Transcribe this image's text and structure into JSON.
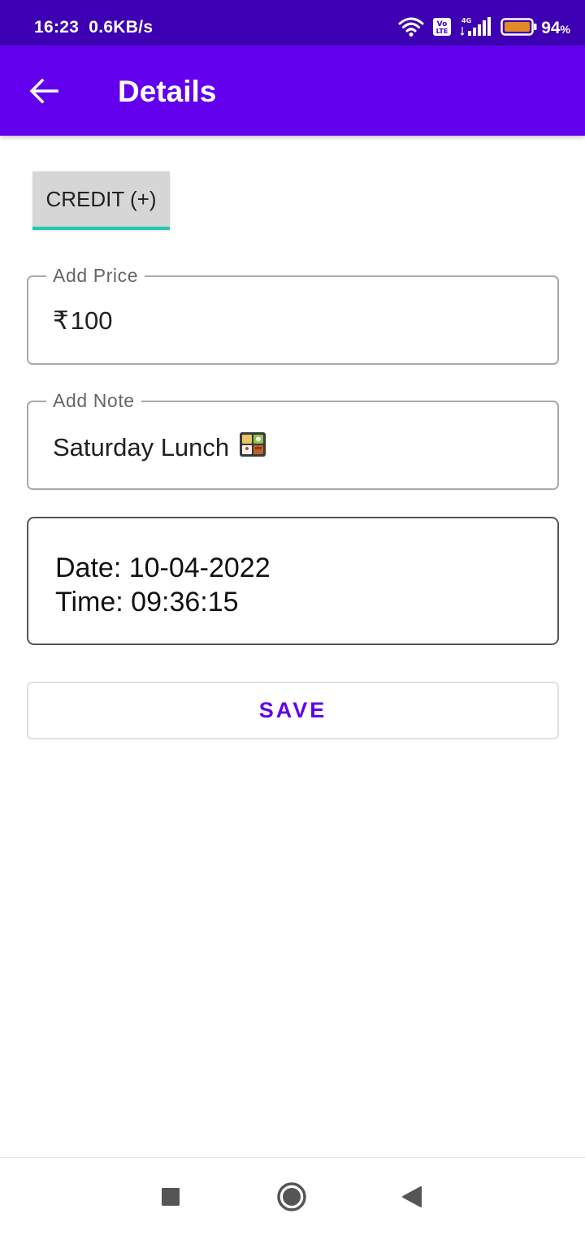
{
  "status_bar": {
    "time": "16:23",
    "network_speed": "0.6KB/s",
    "signal_label": "4G",
    "volte_label": "Vo LTE",
    "battery_percent": "94",
    "battery_unit": "%",
    "icons": [
      "wifi-icon",
      "volte-icon",
      "signal-icon",
      "battery-icon"
    ]
  },
  "app_bar": {
    "title": "Details",
    "back_icon": "arrow-left-icon",
    "color": "#6200ee"
  },
  "tab": {
    "label": "CREDIT (+)",
    "indicator_color": "#1ec9b3"
  },
  "price_field": {
    "label": "Add Price",
    "currency_symbol": "₹",
    "value": "100"
  },
  "note_field": {
    "label": "Add Note",
    "value": "Saturday Lunch",
    "emoji_icon": "bento-box-icon"
  },
  "datetime": {
    "date_text": "Date: 10-04-2022",
    "time_text": "Time: 09:36:15"
  },
  "save_button": {
    "label": "SAVE"
  },
  "nav_bar": {
    "icons": [
      "recents-square-icon",
      "home-circle-icon",
      "back-triangle-icon"
    ]
  }
}
